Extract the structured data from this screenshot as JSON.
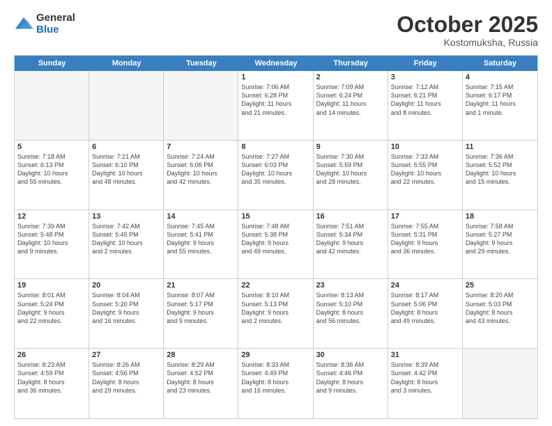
{
  "logo": {
    "general": "General",
    "blue": "Blue"
  },
  "title": "October 2025",
  "location": "Kostomuksha, Russia",
  "days_of_week": [
    "Sunday",
    "Monday",
    "Tuesday",
    "Wednesday",
    "Thursday",
    "Friday",
    "Saturday"
  ],
  "weeks": [
    [
      {
        "day": "",
        "info": ""
      },
      {
        "day": "",
        "info": ""
      },
      {
        "day": "",
        "info": ""
      },
      {
        "day": "1",
        "info": "Sunrise: 7:06 AM\nSunset: 6:28 PM\nDaylight: 11 hours\nand 21 minutes."
      },
      {
        "day": "2",
        "info": "Sunrise: 7:09 AM\nSunset: 6:24 PM\nDaylight: 11 hours\nand 14 minutes."
      },
      {
        "day": "3",
        "info": "Sunrise: 7:12 AM\nSunset: 6:21 PM\nDaylight: 11 hours\nand 8 minutes."
      },
      {
        "day": "4",
        "info": "Sunrise: 7:15 AM\nSunset: 6:17 PM\nDaylight: 11 hours\nand 1 minute."
      }
    ],
    [
      {
        "day": "5",
        "info": "Sunrise: 7:18 AM\nSunset: 6:13 PM\nDaylight: 10 hours\nand 55 minutes."
      },
      {
        "day": "6",
        "info": "Sunrise: 7:21 AM\nSunset: 6:10 PM\nDaylight: 10 hours\nand 48 minutes."
      },
      {
        "day": "7",
        "info": "Sunrise: 7:24 AM\nSunset: 6:06 PM\nDaylight: 10 hours\nand 42 minutes."
      },
      {
        "day": "8",
        "info": "Sunrise: 7:27 AM\nSunset: 6:03 PM\nDaylight: 10 hours\nand 35 minutes."
      },
      {
        "day": "9",
        "info": "Sunrise: 7:30 AM\nSunset: 5:59 PM\nDaylight: 10 hours\nand 28 minutes."
      },
      {
        "day": "10",
        "info": "Sunrise: 7:33 AM\nSunset: 5:55 PM\nDaylight: 10 hours\nand 22 minutes."
      },
      {
        "day": "11",
        "info": "Sunrise: 7:36 AM\nSunset: 5:52 PM\nDaylight: 10 hours\nand 15 minutes."
      }
    ],
    [
      {
        "day": "12",
        "info": "Sunrise: 7:39 AM\nSunset: 5:48 PM\nDaylight: 10 hours\nand 9 minutes."
      },
      {
        "day": "13",
        "info": "Sunrise: 7:42 AM\nSunset: 5:45 PM\nDaylight: 10 hours\nand 2 minutes."
      },
      {
        "day": "14",
        "info": "Sunrise: 7:45 AM\nSunset: 5:41 PM\nDaylight: 9 hours\nand 55 minutes."
      },
      {
        "day": "15",
        "info": "Sunrise: 7:48 AM\nSunset: 5:38 PM\nDaylight: 9 hours\nand 49 minutes."
      },
      {
        "day": "16",
        "info": "Sunrise: 7:51 AM\nSunset: 5:34 PM\nDaylight: 9 hours\nand 42 minutes."
      },
      {
        "day": "17",
        "info": "Sunrise: 7:55 AM\nSunset: 5:31 PM\nDaylight: 9 hours\nand 36 minutes."
      },
      {
        "day": "18",
        "info": "Sunrise: 7:58 AM\nSunset: 5:27 PM\nDaylight: 9 hours\nand 29 minutes."
      }
    ],
    [
      {
        "day": "19",
        "info": "Sunrise: 8:01 AM\nSunset: 5:24 PM\nDaylight: 9 hours\nand 22 minutes."
      },
      {
        "day": "20",
        "info": "Sunrise: 8:04 AM\nSunset: 5:20 PM\nDaylight: 9 hours\nand 16 minutes."
      },
      {
        "day": "21",
        "info": "Sunrise: 8:07 AM\nSunset: 5:17 PM\nDaylight: 9 hours\nand 9 minutes."
      },
      {
        "day": "22",
        "info": "Sunrise: 8:10 AM\nSunset: 5:13 PM\nDaylight: 9 hours\nand 2 minutes."
      },
      {
        "day": "23",
        "info": "Sunrise: 8:13 AM\nSunset: 5:10 PM\nDaylight: 8 hours\nand 56 minutes."
      },
      {
        "day": "24",
        "info": "Sunrise: 8:17 AM\nSunset: 5:06 PM\nDaylight: 8 hours\nand 49 minutes."
      },
      {
        "day": "25",
        "info": "Sunrise: 8:20 AM\nSunset: 5:03 PM\nDaylight: 8 hours\nand 43 minutes."
      }
    ],
    [
      {
        "day": "26",
        "info": "Sunrise: 8:23 AM\nSunset: 4:59 PM\nDaylight: 8 hours\nand 36 minutes."
      },
      {
        "day": "27",
        "info": "Sunrise: 8:26 AM\nSunset: 4:56 PM\nDaylight: 8 hours\nand 29 minutes."
      },
      {
        "day": "28",
        "info": "Sunrise: 8:29 AM\nSunset: 4:52 PM\nDaylight: 8 hours\nand 23 minutes."
      },
      {
        "day": "29",
        "info": "Sunrise: 8:33 AM\nSunset: 4:49 PM\nDaylight: 8 hours\nand 16 minutes."
      },
      {
        "day": "30",
        "info": "Sunrise: 8:36 AM\nSunset: 4:46 PM\nDaylight: 8 hours\nand 9 minutes."
      },
      {
        "day": "31",
        "info": "Sunrise: 8:39 AM\nSunset: 4:42 PM\nDaylight: 8 hours\nand 3 minutes."
      },
      {
        "day": "",
        "info": ""
      }
    ]
  ]
}
